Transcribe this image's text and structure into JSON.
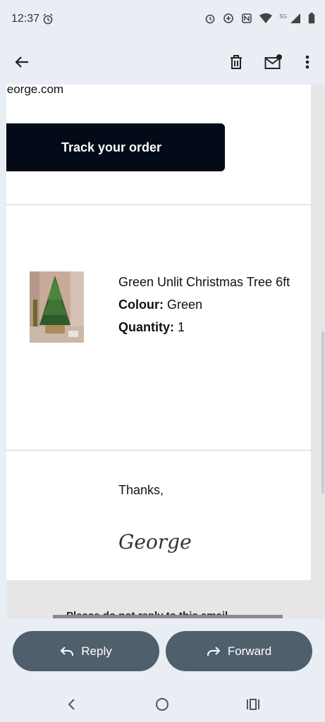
{
  "status": {
    "time": "12:37",
    "network": "5G"
  },
  "email": {
    "sender_fragment": "jeorge.com",
    "track_button": "Track your order",
    "product": {
      "name": "Green Unlit Christmas Tree 6ft",
      "colour_label": "Colour:",
      "colour_value": "Green",
      "quantity_label": "Quantity:",
      "quantity_value": "1"
    },
    "thanks": "Thanks,",
    "signature": "George",
    "footer_note": "Please do not reply to this email"
  },
  "actions": {
    "reply": "Reply",
    "forward": "Forward"
  },
  "icons": [
    "alarm-icon",
    "back-arrow-icon",
    "delete-icon",
    "mark-unread-icon",
    "more-icon",
    "reply-icon",
    "forward-icon",
    "nav-back-icon",
    "nav-home-icon",
    "nav-recents-icon"
  ]
}
